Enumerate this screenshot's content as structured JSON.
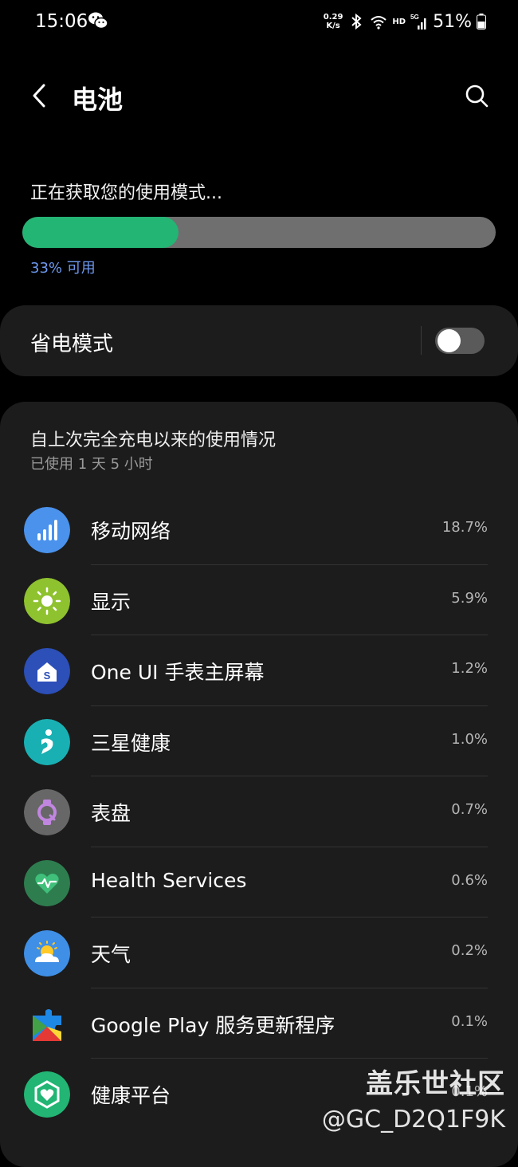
{
  "status_bar": {
    "time": "15:06",
    "net_speed_value": "0.29",
    "net_speed_unit": "K/s",
    "hd_label": "HD",
    "battery_percent": "51%"
  },
  "header": {
    "title": "电池"
  },
  "battery": {
    "status_text": "正在获取您的使用模式...",
    "available_label": "33% 可用",
    "level_percent": 33,
    "fill_color": "#23b574"
  },
  "power_saving": {
    "label": "省电模式",
    "enabled": false
  },
  "usage": {
    "title": "自上次完全充电以来的使用情况",
    "subtitle": "已使用 1 天 5 小时",
    "items": [
      {
        "name": "移动网络",
        "percent": "18.7%",
        "icon": "mobile-network-icon"
      },
      {
        "name": "显示",
        "percent": "5.9%",
        "icon": "display-brightness-icon"
      },
      {
        "name": "One UI 手表主屏幕",
        "percent": "1.2%",
        "icon": "oneui-watch-home-icon"
      },
      {
        "name": "三星健康",
        "percent": "1.0%",
        "icon": "samsung-health-icon"
      },
      {
        "name": "表盘",
        "percent": "0.7%",
        "icon": "watch-face-icon"
      },
      {
        "name": "Health Services",
        "percent": "0.6%",
        "icon": "health-services-icon"
      },
      {
        "name": "天气",
        "percent": "0.2%",
        "icon": "weather-icon"
      },
      {
        "name": "Google Play 服务更新程序",
        "percent": "0.1%",
        "icon": "google-play-services-icon"
      },
      {
        "name": "健康平台",
        "percent": "0.1%",
        "icon": "health-platform-icon"
      }
    ]
  },
  "watermark": {
    "line1": "盖乐世社区",
    "line2": "@GC_D2Q1F9K"
  }
}
